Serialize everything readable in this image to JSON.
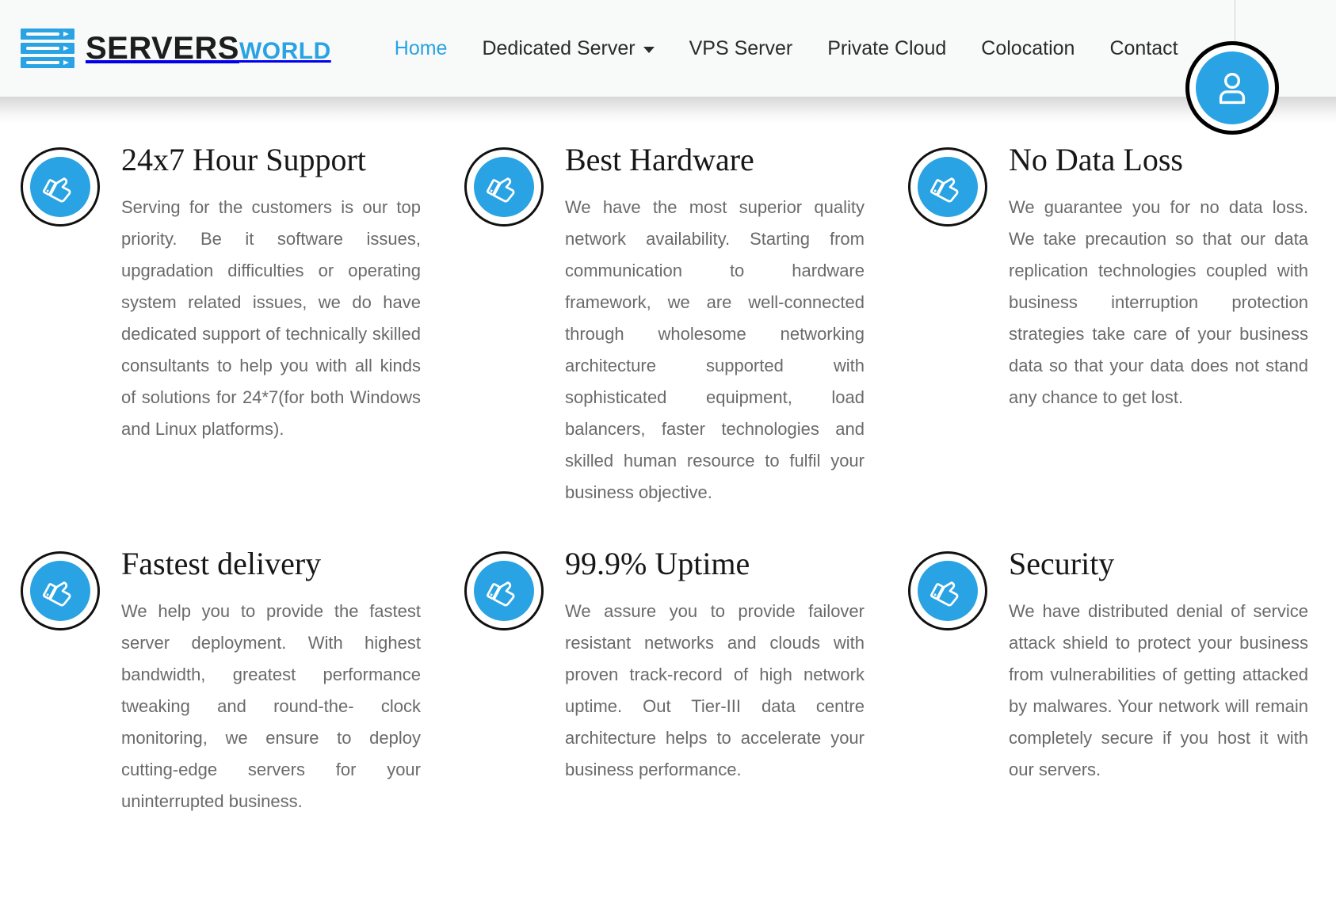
{
  "brand": {
    "name_primary": "SERVERS",
    "name_secondary": "WORLD",
    "logo_icon": "server-rack-icon"
  },
  "nav": {
    "items": [
      {
        "label": "Home",
        "active": true,
        "dropdown": false
      },
      {
        "label": "Dedicated Server",
        "active": false,
        "dropdown": true
      },
      {
        "label": "VPS Server",
        "active": false,
        "dropdown": false
      },
      {
        "label": "Private Cloud",
        "active": false,
        "dropdown": false
      },
      {
        "label": "Colocation",
        "active": false,
        "dropdown": false
      },
      {
        "label": "Contact",
        "active": false,
        "dropdown": false
      }
    ]
  },
  "account": {
    "icon": "user-account-icon"
  },
  "colors": {
    "accent": "#29a3e3",
    "header_bg": "#f8f9f9",
    "body_text": "#6a6a6a",
    "heading_text": "#171717",
    "nav_text": "#2b2b2b",
    "ring": "#111111"
  },
  "features": [
    {
      "icon": "thumbs-up-icon",
      "title": "24x7 Hour Support",
      "text": "Serving for the customers is our top priority. Be it software issues, upgradation difficulties or operating system related issues, we do have dedicated support of technically skilled consultants to help you with all kinds of solutions for 24*7(for both Windows and Linux platforms)."
    },
    {
      "icon": "thumbs-up-icon",
      "title": "Best Hardware",
      "text": "We have the most superior quality network availability. Starting from communication to hardware framework, we are well-connected through wholesome networking architecture supported with sophisticated equipment, load balancers, faster technologies and skilled human resource to fulfil your business objective."
    },
    {
      "icon": "thumbs-up-icon",
      "title": "No Data Loss",
      "text": "We guarantee you for no data loss. We take precaution so that our data replication technologies coupled with business interruption protection strategies take care of your business data so that your data does not stand any chance to get lost."
    },
    {
      "icon": "thumbs-up-icon",
      "title": "Fastest delivery",
      "text": "We help you to provide the fastest server deployment. With highest bandwidth, greatest performance tweaking and round-the- clock monitoring, we ensure to deploy cutting-edge servers for your uninterrupted business."
    },
    {
      "icon": "thumbs-up-icon",
      "title": "99.9% Uptime",
      "text": "We assure you to provide failover resistant networks and clouds with proven track-record of high network uptime. Out Tier-III data centre architecture helps to accelerate your business performance."
    },
    {
      "icon": "thumbs-up-icon",
      "title": "Security",
      "text": "We have distributed denial of service attack shield to protect your business from vulnerabilities of getting attacked by malwares. Your network will remain completely secure if you host it with our servers."
    }
  ]
}
